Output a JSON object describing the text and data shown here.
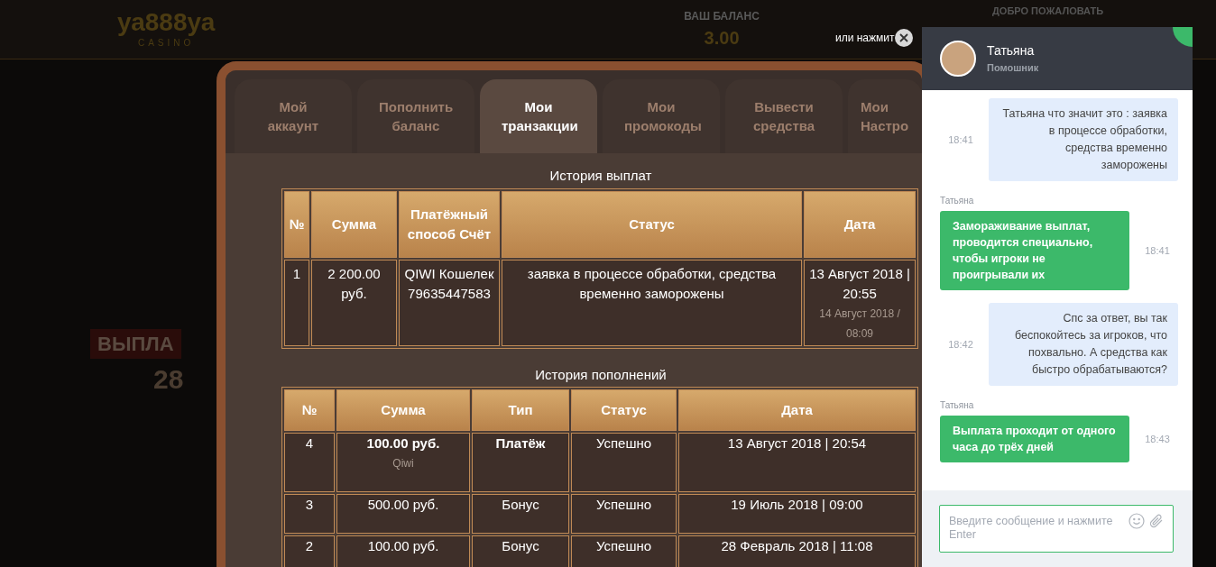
{
  "background": {
    "logo": "уа888уа",
    "logo_sub": "CASINO",
    "balance_label": "ВАШ БАЛАНС",
    "balance_value": "3.00",
    "welcome": "ДОБРО ПОЖАЛОВАТЬ",
    "banner": "ВЫПЛА",
    "banner_value": "28"
  },
  "close_hint": {
    "text": "или нажмит"
  },
  "tabs": [
    {
      "label": "Мой аккаунт",
      "selected": false
    },
    {
      "label": "Пополнить баланс",
      "selected": false
    },
    {
      "label": "Мои транзакции",
      "selected": true
    },
    {
      "label": "Мои промокоды",
      "selected": false
    },
    {
      "label": "Вывести средства",
      "selected": false
    },
    {
      "label": "Мои Настро",
      "selected": false
    }
  ],
  "payouts": {
    "title": "История выплат",
    "columns": [
      "№",
      "Сумма",
      "Платёжный способ Счёт",
      "Статус",
      "Дата"
    ],
    "rows": [
      {
        "number": "1",
        "amount": "2 200.00 руб.",
        "method": "QIWI Кошелек 79635447583",
        "status": "заявка в процессе обработки, средства временно заморожены",
        "date": "13 Август 2018 | 20:55",
        "updated": "14 Август 2018 / 08:09"
      }
    ]
  },
  "deposits": {
    "title": "История пополнений",
    "columns": [
      "№",
      "Сумма",
      "Тип",
      "Статус",
      "Дата"
    ],
    "rows": [
      {
        "number": "4",
        "amount": "100.00 руб.",
        "method": "Qiwi",
        "type": "Платёж",
        "status": "Успешно",
        "date": "13 Август 2018 | 20:54",
        "highlight": true
      },
      {
        "number": "3",
        "amount": "500.00 руб.",
        "type": "Бонус",
        "status": "Успешно",
        "date": "19 Июль 2018 | 09:00",
        "highlight": false
      },
      {
        "number": "2",
        "amount": "100.00 руб.",
        "type": "Бонус",
        "status": "Успешно",
        "date": "28 Февраль 2018 | 11:08",
        "highlight": false
      }
    ]
  },
  "chat": {
    "agent_name": "Татьяна",
    "agent_role": "Помошник",
    "messages": [
      {
        "kind": "user",
        "text": "Татьяна что значит это : заявка в процессе обработки, средства временно заморожены",
        "time": "18:41"
      },
      {
        "kind": "agent",
        "sender": "Татьяна",
        "text": "Замораживание выплат, проводится специально, чтобы игроки не проигрывали их",
        "time": "18:41"
      },
      {
        "kind": "user",
        "text": "Спс за ответ, вы так беспокойтесь за игроков, что похвально. А средства как быстро обрабатываются?",
        "time": "18:42"
      },
      {
        "kind": "agent",
        "sender": "Татьяна",
        "text": "Выплата проходит от одного часа до трёх дней",
        "time": "18:43"
      }
    ],
    "input": {
      "placeholder": "Введите сообщение и нажмите Enter"
    }
  }
}
